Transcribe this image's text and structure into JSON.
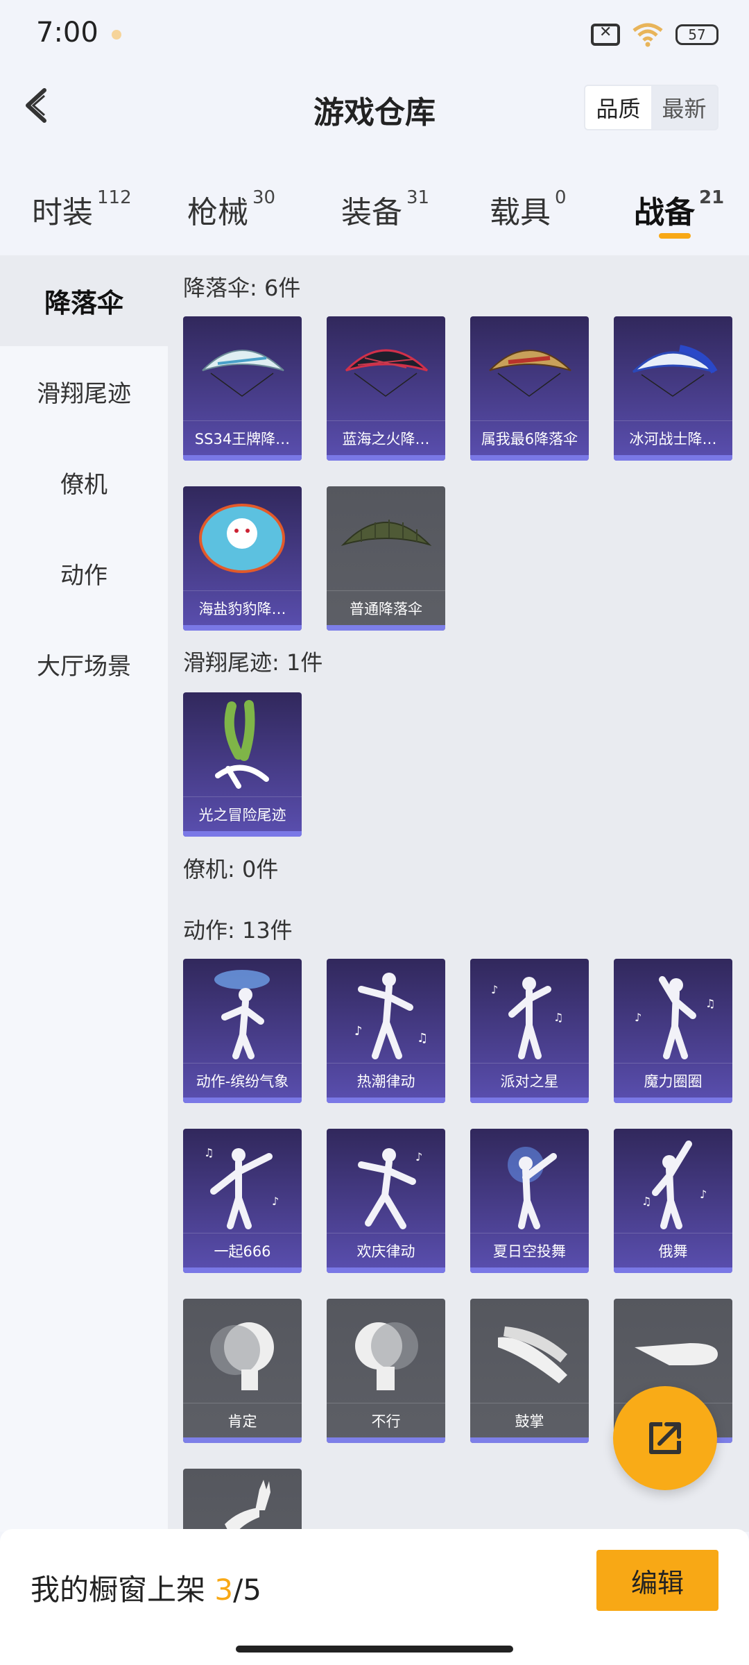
{
  "status": {
    "time": "7:00",
    "battery": "57"
  },
  "header": {
    "title": "游戏仓库",
    "sort_quality": "品质",
    "sort_latest": "最新"
  },
  "tabs": [
    {
      "label": "时装",
      "count": "112"
    },
    {
      "label": "枪械",
      "count": "30"
    },
    {
      "label": "装备",
      "count": "31"
    },
    {
      "label": "载具",
      "count": "0"
    },
    {
      "label": "战备",
      "count": "21"
    }
  ],
  "sidebar": [
    "降落伞",
    "滑翔尾迹",
    "僚机",
    "动作",
    "大厅场景"
  ],
  "sections": {
    "parachute_title": "降落伞: 6件",
    "trail_title": "滑翔尾迹: 1件",
    "wingman_title": "僚机: 0件",
    "emote_title": "动作: 13件"
  },
  "parachutes": [
    "SS34王牌降…",
    "蓝海之火降…",
    "属我最6降落伞",
    "冰河战士降…",
    "海盐豹豹降…",
    "普通降落伞"
  ],
  "trails": [
    "光之冒险尾迹"
  ],
  "emotes": [
    "动作-缤纷气象",
    "热潮律动",
    "派对之星",
    "魔力圈圈",
    "一起666",
    "欢庆律动",
    "夏日空投舞",
    "俄舞",
    "肯定",
    "不行",
    "鼓掌",
    "",
    ""
  ],
  "bottom": {
    "prefix": "我的橱窗上架 ",
    "current": "3",
    "total": "/5",
    "edit_label": "编辑"
  },
  "colors": {
    "accent": "#f8a815",
    "card_purple": "#4a3f8e",
    "card_grey": "#5d5f66"
  }
}
